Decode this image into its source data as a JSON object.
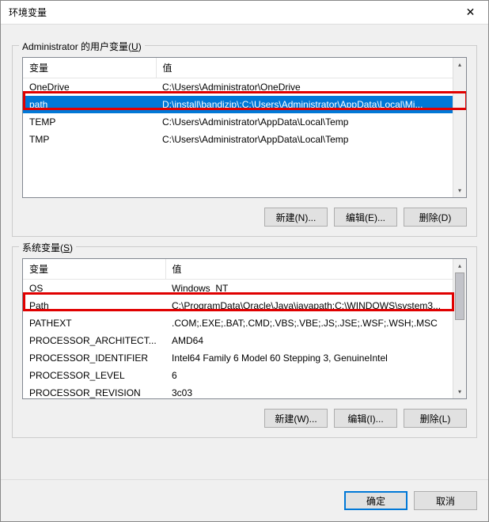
{
  "window": {
    "title": "环境变量",
    "close_icon": "✕"
  },
  "user_section": {
    "label_pre": "Administrator 的用户变量(",
    "label_key": "U",
    "label_post": ")",
    "col_var": "变量",
    "col_val": "值",
    "rows": [
      {
        "name": "OneDrive",
        "value": "C:\\Users\\Administrator\\OneDrive",
        "selected": false
      },
      {
        "name": "path",
        "value": "D:\\install\\bandizip\\;C:\\Users\\Administrator\\AppData\\Local\\Mi...",
        "selected": true
      },
      {
        "name": "TEMP",
        "value": "C:\\Users\\Administrator\\AppData\\Local\\Temp",
        "selected": false
      },
      {
        "name": "TMP",
        "value": "C:\\Users\\Administrator\\AppData\\Local\\Temp",
        "selected": false
      }
    ],
    "btn_new": "新建(N)...",
    "btn_edit": "编辑(E)...",
    "btn_delete": "删除(D)"
  },
  "system_section": {
    "label_pre": "系统变量(",
    "label_key": "S",
    "label_post": ")",
    "col_var": "变量",
    "col_val": "值",
    "rows": [
      {
        "name": "OS",
        "value": "Windows_NT"
      },
      {
        "name": "Path",
        "value": "C:\\ProgramData\\Oracle\\Java\\javapath;C:\\WINDOWS\\system3..."
      },
      {
        "name": "PATHEXT",
        "value": ".COM;.EXE;.BAT;.CMD;.VBS;.VBE;.JS;.JSE;.WSF;.WSH;.MSC"
      },
      {
        "name": "PROCESSOR_ARCHITECT...",
        "value": "AMD64"
      },
      {
        "name": "PROCESSOR_IDENTIFIER",
        "value": "Intel64 Family 6 Model 60 Stepping 3, GenuineIntel"
      },
      {
        "name": "PROCESSOR_LEVEL",
        "value": "6"
      },
      {
        "name": "PROCESSOR_REVISION",
        "value": "3c03"
      }
    ],
    "btn_new": "新建(W)...",
    "btn_edit": "编辑(I)...",
    "btn_delete": "删除(L)"
  },
  "dialog": {
    "ok": "确定",
    "cancel": "取消"
  }
}
